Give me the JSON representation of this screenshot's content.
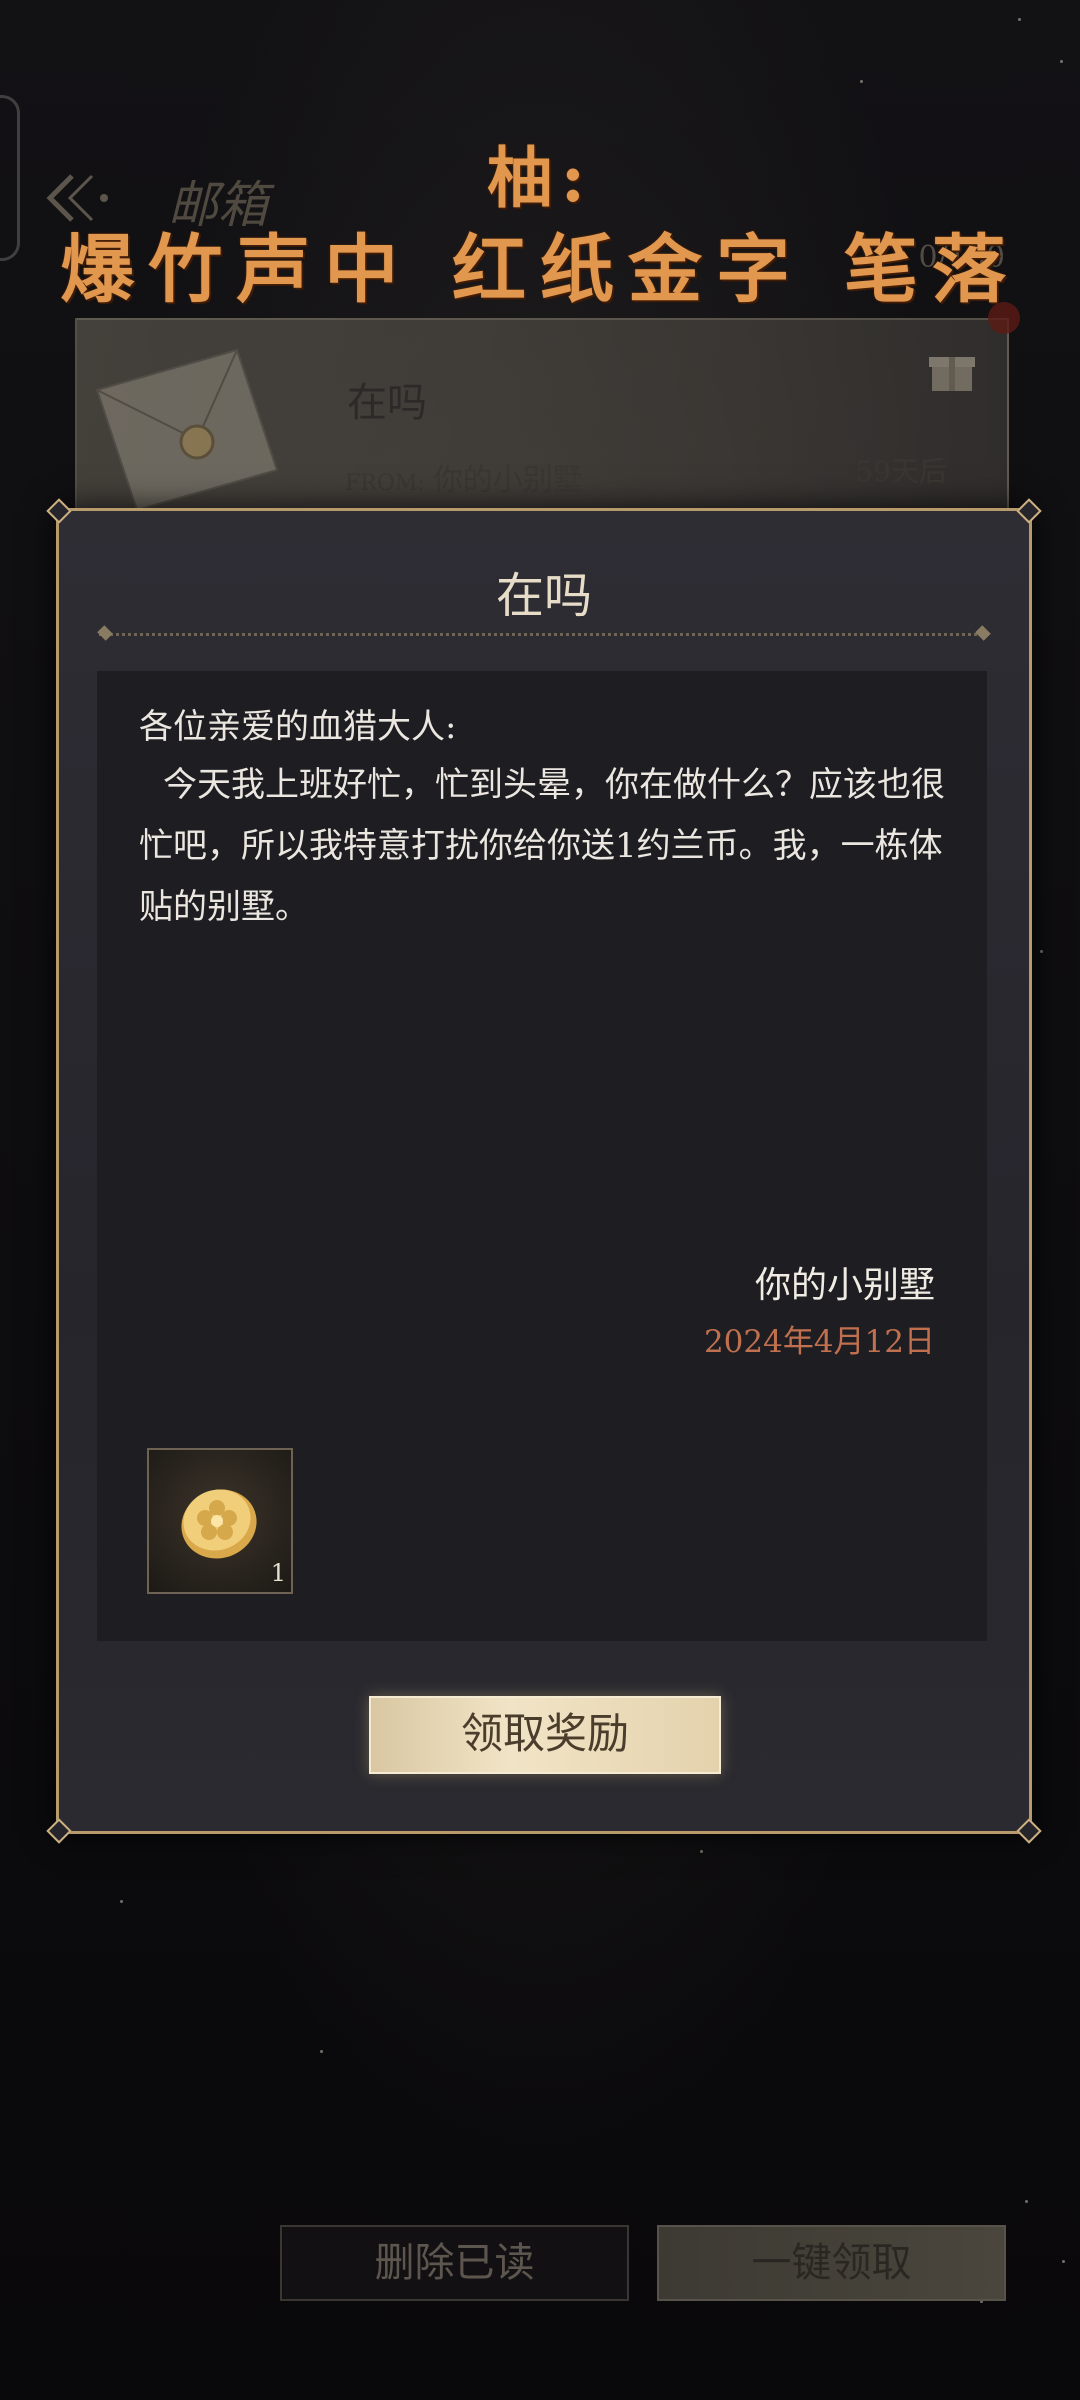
{
  "caption": {
    "line1": "柚:",
    "line2": "爆竹声中 红纸金字 笔落"
  },
  "header": {
    "title": "邮箱",
    "count": "0/100"
  },
  "mail_card": {
    "title": "在吗",
    "from_label": "FROM:",
    "from_name": "你的小别墅",
    "expiry": "59天后"
  },
  "dialog": {
    "title": "在吗",
    "greeting": "各位亲爱的血猎大人:",
    "message": "今天我上班好忙，忙到头晕，你在做什么？应该也很忙吧，所以我特意打扰你给你送1约兰币。我，一栋体贴的别墅。",
    "signature": "你的小别墅",
    "date": "2024年4月12日",
    "reward": {
      "icon": "gold-coin-icon",
      "count": "1"
    },
    "claim_button": "领取奖励"
  },
  "bottom": {
    "delete_read": "删除已读",
    "claim_all": "一键领取"
  },
  "colors": {
    "accent_gold": "#b79b6a",
    "caption_orange": "#e2974e",
    "date_color": "#c0704e"
  }
}
